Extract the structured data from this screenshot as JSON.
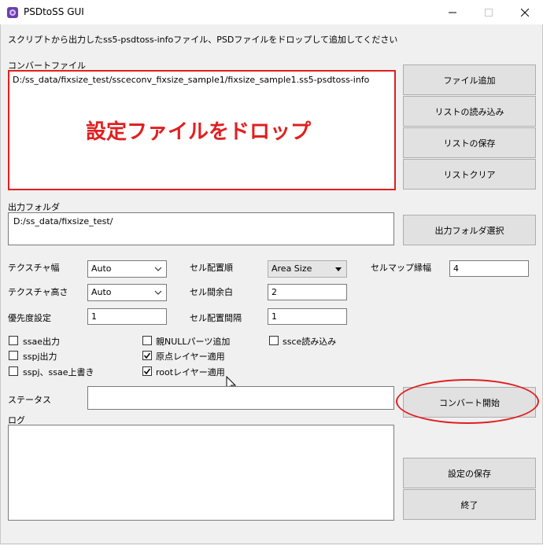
{
  "window": {
    "title": "PSDtoSS GUI",
    "accent_red": "#e02020"
  },
  "instructions": "スクリプトから出力したss5-psdtoss-infoファイル、PSDファイルをドロップして追加してください",
  "convert": {
    "label": "コンバートファイル",
    "file": "D:/ss_data/fixsize_test/ssceconv_fixsize_sample1/fixsize_sample1.ss5-psdtoss-info",
    "drop_hint": "設定ファイルをドロップ"
  },
  "buttons": {
    "add_file": "ファイル追加",
    "load_list": "リストの読み込み",
    "save_list": "リストの保存",
    "clear_list": "リストクリア",
    "select_output": "出力フォルダ選択",
    "start_convert": "コンバート開始",
    "save_settings": "設定の保存",
    "exit": "終了"
  },
  "output": {
    "label": "出力フォルダ",
    "path": "D:/ss_data/fixsize_test/"
  },
  "settings": {
    "texture_width_label": "テクスチャ幅",
    "texture_width": "Auto",
    "texture_height_label": "テクスチャ高さ",
    "texture_height": "Auto",
    "priority_label": "優先度設定",
    "priority": "1",
    "cell_order_label": "セル配置順",
    "cell_order": "Area Size",
    "cell_margin_label": "セル間余白",
    "cell_margin": "2",
    "cell_spacing_label": "セル配置間隔",
    "cell_spacing": "1",
    "cellmap_border_label": "セルマップ縁幅",
    "cellmap_border": "4"
  },
  "checkboxes": {
    "ssae": "ssae出力",
    "sspj": "sspj出力",
    "overwrite": "sspj、ssae上書き",
    "null_parts": "親NULLパーツ追加",
    "origin_layer": "原点レイヤー適用",
    "root_layer": "rootレイヤー適用",
    "ssce_read": "ssce読み込み"
  },
  "status_label": "ステータス",
  "log_label": "ログ"
}
